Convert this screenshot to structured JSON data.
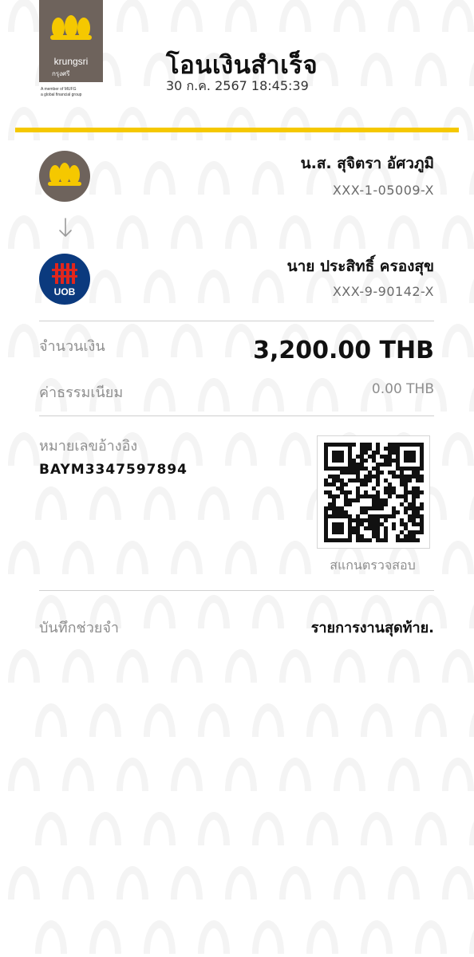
{
  "header": {
    "logo_brand": "krungsri",
    "logo_thai": "กรุงศรี",
    "logo_tagline_1": "A member of MUFG",
    "logo_tagline_2": "a global financial group",
    "title": "โอนเงินสำเร็จ",
    "datetime": "30 ก.ค. 2567 18:45:39"
  },
  "colors": {
    "accent_yellow": "#f5c800",
    "krungsri_grey": "#6e635c",
    "uob_navy": "#0b3a7e",
    "uob_red": "#e1261c"
  },
  "sender": {
    "icon": "krungsri-logo-icon",
    "name": "น.ส. สุจิตรา อัศวภูมิ",
    "account": "XXX-1-05009-X"
  },
  "receiver": {
    "icon": "uob-logo-icon",
    "logo_text": "UOB",
    "name": "นาย ประสิทธิ์ ครองสุข",
    "account": "XXX-9-90142-X"
  },
  "amount": {
    "label": "จำนวนเงิน",
    "value": "3,200.00 THB"
  },
  "fee": {
    "label": "ค่าธรรมเนียม",
    "value": "0.00 THB"
  },
  "reference": {
    "label": "หมายเลขอ้างอิง",
    "value": "BAYM3347597894"
  },
  "qr": {
    "caption": "สแกนตรวจสอบ"
  },
  "memo": {
    "label": "บันทึกช่วยจำ",
    "value": "รายการงานสุดท้าย."
  }
}
